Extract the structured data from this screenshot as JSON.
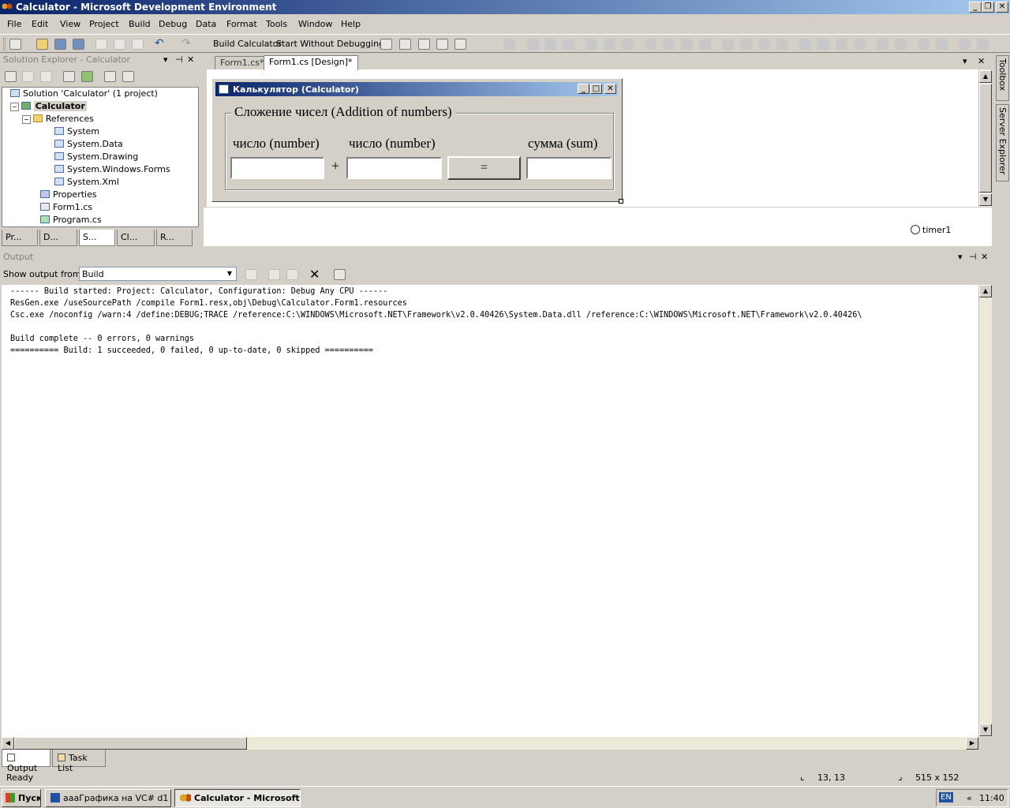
{
  "window": {
    "title": "Calculator - Microsoft Development Environment"
  },
  "menu": [
    "File",
    "Edit",
    "View",
    "Project",
    "Build",
    "Debug",
    "Data",
    "Format",
    "Tools",
    "Window",
    "Help"
  ],
  "toolbar": {
    "build_label": "Build Calculator",
    "start_label": "Start Without Debugging"
  },
  "solution_explorer": {
    "title": "Solution Explorer - Calculator",
    "items": [
      "Solution 'Calculator' (1 project)",
      "Calculator",
      "References",
      "System",
      "System.Data",
      "System.Drawing",
      "System.Windows.Forms",
      "System.Xml",
      "Properties",
      "Form1.cs",
      "Program.cs"
    ],
    "tabs": [
      "Pr...",
      "D...",
      "S...",
      "Cl...",
      "R..."
    ]
  },
  "editor": {
    "tabs": [
      "Form1.cs*",
      "Form1.cs [Design]*"
    ],
    "form": {
      "title": "Калькулятор (Calculator)",
      "group_title": "Сложение чисел (Addition of numbers)",
      "label1": "число (number)",
      "label2": "число (number)",
      "label3": "сумма (sum)",
      "plus": "+",
      "equals": "="
    },
    "tray_component": "timer1"
  },
  "side_tabs": [
    "Toolbox",
    "Server Explorer"
  ],
  "output": {
    "title": "Output",
    "show_from_label": "Show output from:",
    "show_from_value": "Build",
    "lines": [
      "------ Build started: Project: Calculator, Configuration: Debug Any CPU ------",
      "ResGen.exe /useSourcePath /compile Form1.resx,obj\\Debug\\Calculator.Form1.resources",
      "Csc.exe /noconfig /warn:4 /define:DEBUG;TRACE /reference:C:\\WINDOWS\\Microsoft.NET\\Framework\\v2.0.40426\\System.Data.dll /reference:C:\\WINDOWS\\Microsoft.NET\\Framework\\v2.0.40426\\",
      "",
      "Build complete -- 0 errors, 0 warnings",
      "========== Build: 1 succeeded, 0 failed, 0 up-to-date, 0 skipped =========="
    ]
  },
  "bottom_tabs": [
    "Output",
    "Task List"
  ],
  "status": {
    "text": "Ready",
    "position": "13, 13",
    "size": "515 x 152"
  },
  "taskbar": {
    "start": "Пуск",
    "items": [
      "аааГрафика на VC# d1 ...",
      "Calculator - Microsoft..."
    ],
    "lang": "EN",
    "time": "11:40"
  }
}
